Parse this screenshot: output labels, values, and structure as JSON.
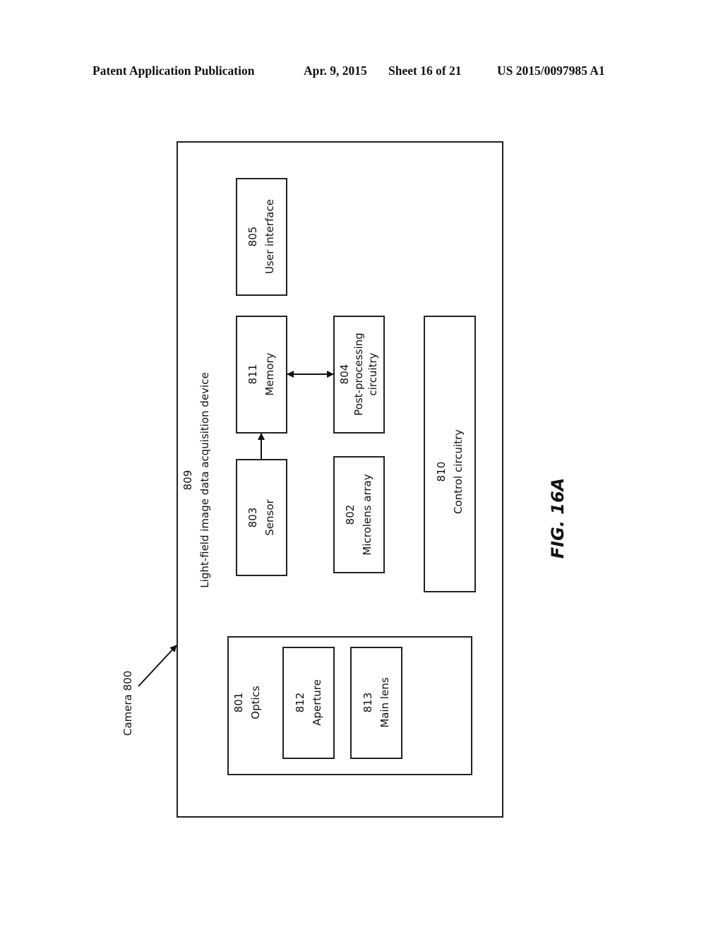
{
  "header": {
    "publication": "Patent Application Publication",
    "date": "Apr. 9, 2015",
    "sheet": "Sheet 16 of 21",
    "number": "US 2015/0097985 A1"
  },
  "diagram": {
    "camera_label": "Camera 800",
    "device": {
      "ref": "809",
      "label": "Light-field image data acquisition device"
    },
    "blocks": {
      "user_interface": {
        "ref": "805",
        "label": "User interface"
      },
      "memory": {
        "ref": "811",
        "label": "Memory"
      },
      "post_processing": {
        "ref": "804",
        "label1": "Post-processing",
        "label2": "circuitry"
      },
      "sensor": {
        "ref": "803",
        "label": "Sensor"
      },
      "microlens": {
        "ref": "802",
        "label": "Microlens array"
      },
      "control": {
        "ref": "810",
        "label": "Control circuitry"
      },
      "optics": {
        "ref": "801",
        "label": "Optics"
      },
      "aperture": {
        "ref": "812",
        "label": "Aperture"
      },
      "main_lens": {
        "ref": "813",
        "label": "Main lens"
      }
    }
  },
  "figure_label": "FIG. 16A"
}
